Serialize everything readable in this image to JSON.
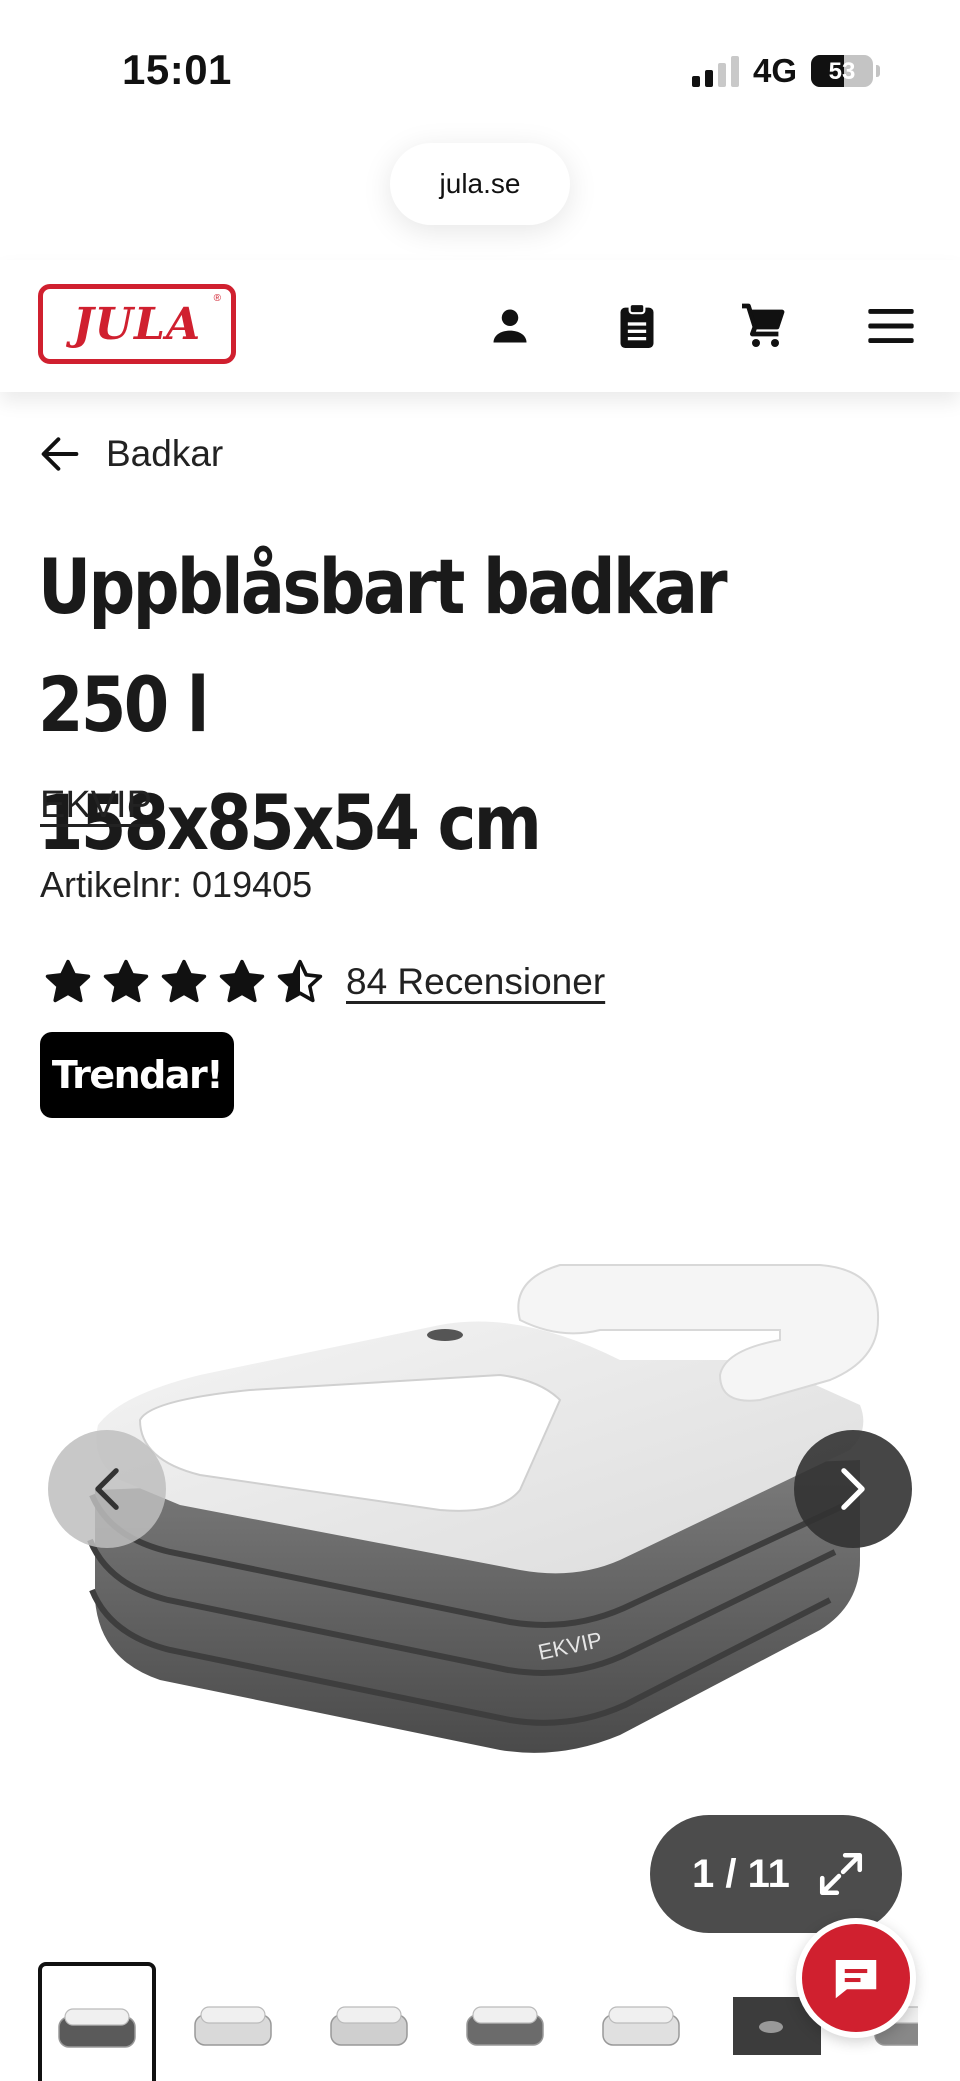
{
  "status_bar": {
    "time": "15:01",
    "network": "4G",
    "battery": "53",
    "battery_level": 0.53
  },
  "browser": {
    "url": "jula.se"
  },
  "header": {
    "logo_text": "JULA",
    "logo_mark": "®",
    "icons": [
      "user-icon",
      "shopping-list-icon",
      "cart-icon",
      "menu-icon"
    ],
    "brand_color": "#d0202f"
  },
  "breadcrumb": {
    "back_icon": "arrow-left-icon",
    "label": "Badkar"
  },
  "product": {
    "title": "Uppblåsbart badkar 250 l 158x85x54 cm",
    "brand": "EKVIP",
    "article_number": "Artikelnr: 019405",
    "rating": 4.5,
    "rating_max": 5,
    "reviews_link": "84 Recensioner",
    "badge": "Trendar!"
  },
  "gallery": {
    "image_brand": "EKVIP",
    "counter": "1 / 11",
    "prev_icon": "chevron-left-icon",
    "next_icon": "chevron-right-icon",
    "expand_icon": "expand-icon",
    "thumbnail_count": 7,
    "active_thumbnail": 1
  },
  "chat": {
    "icon": "chat-icon"
  }
}
